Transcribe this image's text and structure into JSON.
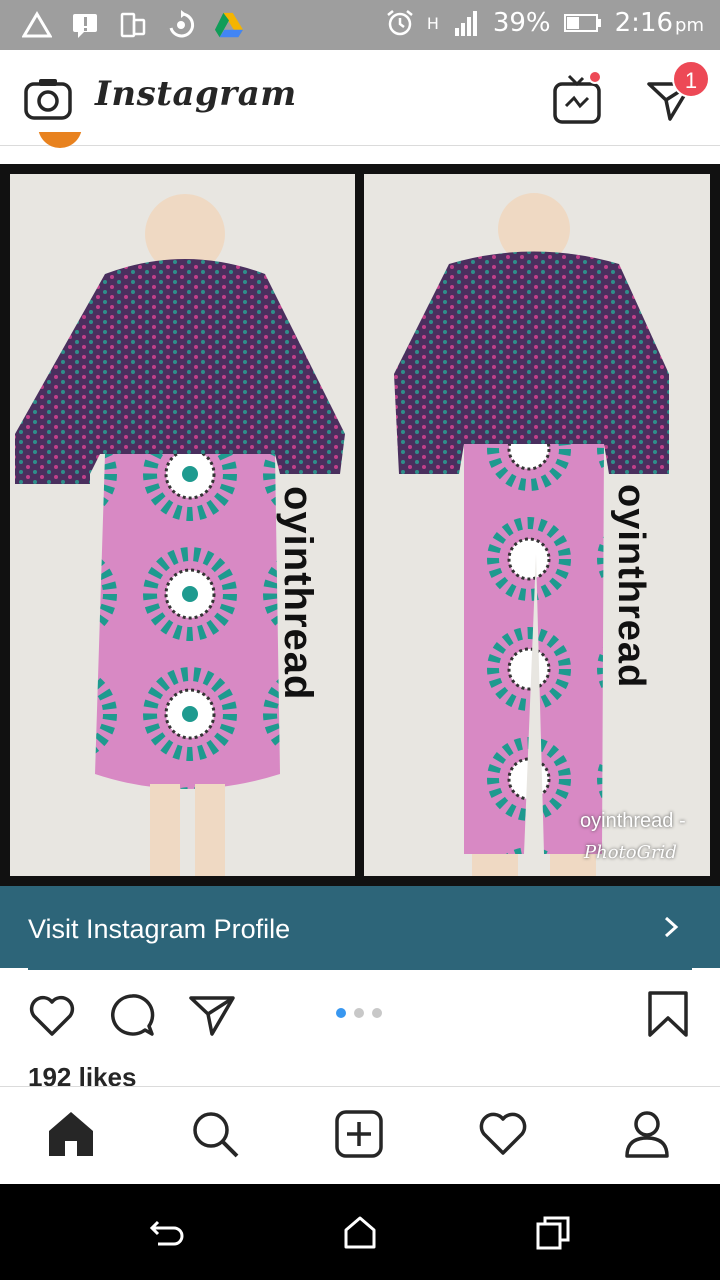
{
  "status_bar": {
    "battery_percent": "39%",
    "time": "2:16",
    "time_suffix": "pm",
    "network_label": "H"
  },
  "header": {
    "brand": "Instagram",
    "direct_badge_count": "1"
  },
  "post": {
    "watermark": "oyinthread",
    "photogrid_text": "oyinthread -",
    "photogrid_label": "PhotoGrid",
    "visit_profile_label": "Visit Instagram Profile",
    "likes": "192 likes",
    "carousel": {
      "total": 3,
      "active": 1
    }
  },
  "colors": {
    "accent_badge": "#ed4956",
    "visit_bar": "#2d6579",
    "active_dot": "#3897f0"
  }
}
